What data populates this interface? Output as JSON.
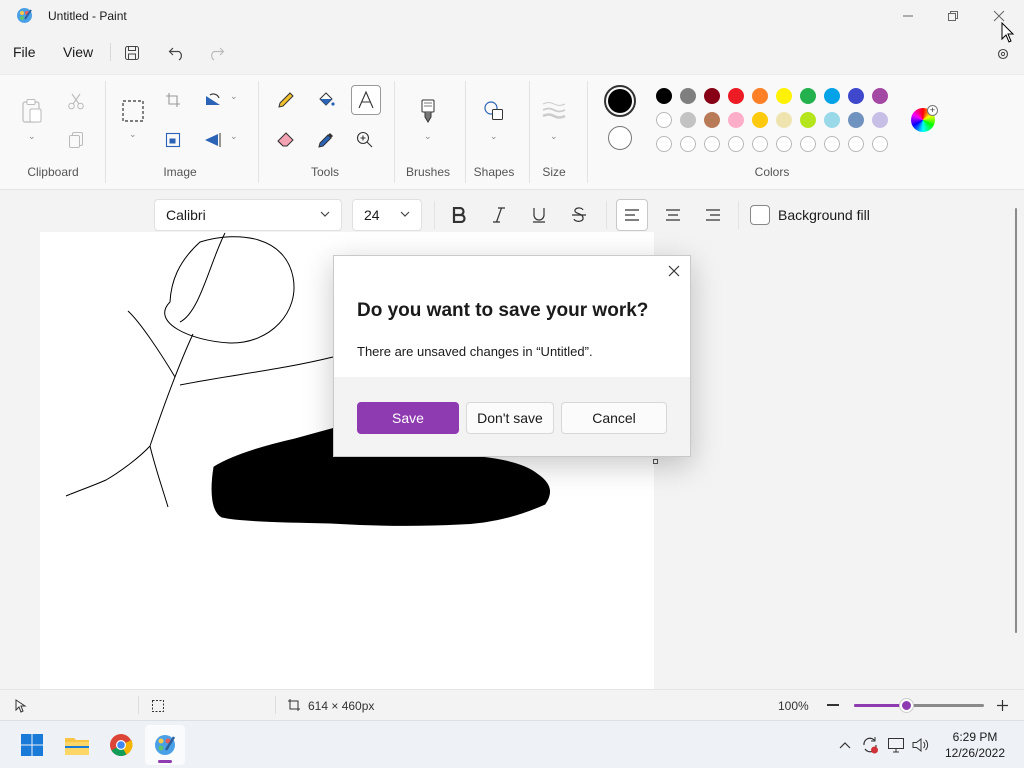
{
  "window": {
    "title": "Untitled - Paint"
  },
  "menu": {
    "file": "File",
    "view": "View"
  },
  "ribbon": {
    "groups": {
      "clipboard": "Clipboard",
      "image": "Image",
      "tools": "Tools",
      "brushes": "Brushes",
      "shapes": "Shapes",
      "size": "Size",
      "colors": "Colors"
    },
    "primary_color": "#000000",
    "secondary_color": "#ffffff",
    "palette_row1": [
      "#000000",
      "#7f7f7f",
      "#880015",
      "#ed1c24",
      "#ff7f27",
      "#fff200",
      "#22b14c",
      "#00a2e8",
      "#3f48cc",
      "#a349a4"
    ],
    "palette_row2": [
      "#ffffff",
      "#c3c3c3",
      "#b97a57",
      "#ffaec9",
      "#ffc90e",
      "#efe4b0",
      "#b5e61d",
      "#99d9ea",
      "#7092be",
      "#c8bfe7"
    ]
  },
  "text_toolbar": {
    "font_name": "Calibri",
    "font_size": "24",
    "background_fill_label": "Background fill"
  },
  "dialog": {
    "title": "Do you want to save your work?",
    "message": "There are unsaved changes in “Untitled”.",
    "save": "Save",
    "dont_save": "Don't save",
    "cancel": "Cancel"
  },
  "status": {
    "canvas_size": "614 × 460px",
    "zoom": "100%",
    "zoom_level": 0.4
  },
  "taskbar": {
    "time": "6:29 PM",
    "date": "12/26/2022"
  },
  "accent_color": "#8e3ab1"
}
